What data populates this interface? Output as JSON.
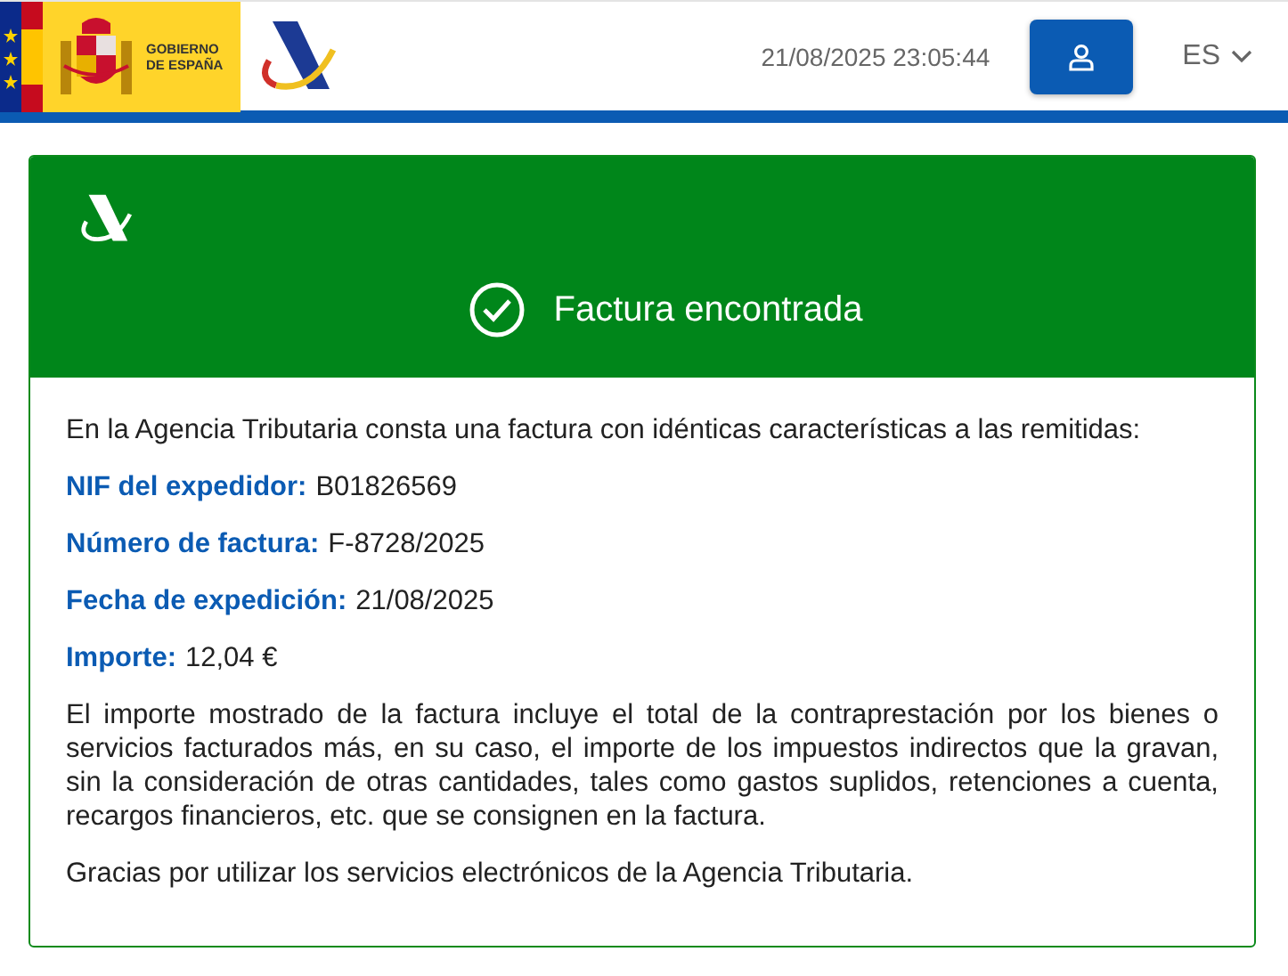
{
  "header": {
    "gov_logo_lines": [
      "GOBIERNO",
      "DE ESPAÑA"
    ],
    "datetime": "21/08/2025 23:05:44",
    "language": "ES"
  },
  "card": {
    "title": "Factura encontrada",
    "intro": "En la Agencia Tributaria consta una factura con idénticas características a las remitidas:",
    "fields": [
      {
        "label": "NIF del expedidor:",
        "value": "B01826569"
      },
      {
        "label": "Número de factura:",
        "value": "F-8728/2025"
      },
      {
        "label": "Fecha de expedición:",
        "value": "21/08/2025"
      },
      {
        "label": "Importe:",
        "value": "12,04 €"
      }
    ],
    "note": "El importe mostrado de la factura incluye el total de la contraprestación por los bienes o servicios facturados más, en su caso, el importe de los impuestos indirectos que la gravan, sin la consideración de otras cantidades, tales como gastos suplidos, retenciones a cuenta, recargos financieros, etc. que se consignen en la factura.",
    "thanks": "Gracias por utilizar los servicios electrónicos de la Agencia Tributaria."
  }
}
